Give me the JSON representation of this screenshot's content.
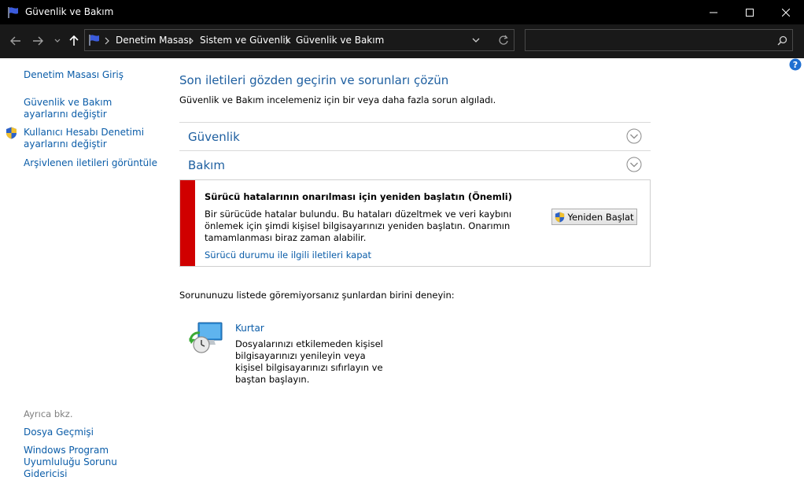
{
  "window": {
    "title": "Güvenlik ve Bakım",
    "icon": "flag-icon"
  },
  "breadcrumb": {
    "items": [
      "Denetim Masası",
      "Sistem ve Güvenlik",
      "Güvenlik ve Bakım"
    ]
  },
  "search": {
    "placeholder": ""
  },
  "sidebar": {
    "items": [
      {
        "label": "Denetim Masası Giriş"
      },
      {
        "label": "Güvenlik ve Bakım ayarlarını değiştir"
      },
      {
        "label": "Kullanıcı Hesabı Denetimi ayarlarını değiştir",
        "icon": "uac-shield-icon"
      },
      {
        "label": "Arşivlenen iletileri görüntüle"
      }
    ],
    "see_also_label": "Ayrıca bkz.",
    "see_also": [
      {
        "label": "Dosya Geçmişi"
      },
      {
        "label": "Windows Program Uyumluluğu Sorunu Gidericisi"
      }
    ]
  },
  "main": {
    "heading": "Son iletileri gözden geçirin ve sorunları çözün",
    "subtext": "Güvenlik ve Bakım incelemeniz için bir veya daha fazla sorun algıladı.",
    "sections": [
      {
        "title": "Güvenlik"
      },
      {
        "title": "Bakım"
      }
    ],
    "alert": {
      "title": "Sürücü hatalarının onarılması için yeniden başlatın  (Önemli)",
      "body": "Bir sürücüde hatalar bulundu. Bu hataları düzeltmek ve veri kaybını önlemek için şimdi kişisel bilgisayarınızı yeniden başlatın. Onarımın tamamlanması biraz zaman alabilir.",
      "button_label": "Yeniden Başlat",
      "link": "Sürücü durumu ile ilgili iletileri kapat",
      "color": "#d00000"
    },
    "try_text": "Sorununuzu listede göremiyorsanız şunlardan birini deneyin:",
    "recovery": {
      "title": "Kurtar",
      "description": "Dosyalarınızı etkilemeden kişisel bilgisayarınızı yenileyin veya kişisel bilgisayarınızı sıfırlayın ve baştan başlayın."
    }
  },
  "colors": {
    "link": "#0a5ca8",
    "heading": "#1e5fa0",
    "titlebar": "#000000",
    "navbar": "#191919"
  }
}
